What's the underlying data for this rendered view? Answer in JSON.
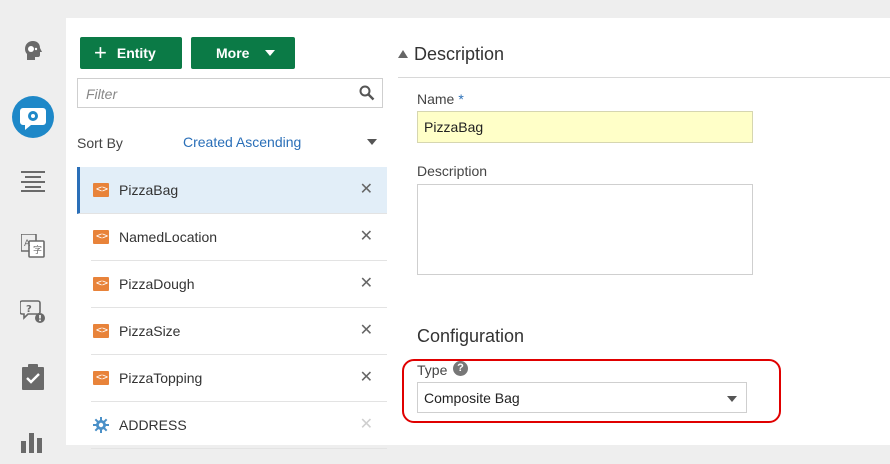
{
  "nav": {
    "items": [
      {
        "icon": "head-bubble-icon"
      },
      {
        "icon": "chat-gear-icon",
        "active": true,
        "color": "#1e88c8"
      },
      {
        "icon": "lines-icon"
      },
      {
        "icon": "translate-icon"
      },
      {
        "icon": "question-chat-icon"
      },
      {
        "icon": "clipboard-check-icon"
      },
      {
        "icon": "bar-chart-icon"
      }
    ]
  },
  "toolbar": {
    "entity_label": "Entity",
    "entity_plus": "+",
    "more_label": "More",
    "accent_color": "#0b7a46"
  },
  "filter": {
    "placeholder": "Filter"
  },
  "sort": {
    "label": "Sort By",
    "value": "Created Ascending"
  },
  "entities": [
    {
      "name": "PizzaBag",
      "icon": "bag-entity-icon",
      "selected": true
    },
    {
      "name": "NamedLocation",
      "icon": "entity-icon"
    },
    {
      "name": "PizzaDough",
      "icon": "entity-icon"
    },
    {
      "name": "PizzaSize",
      "icon": "entity-icon"
    },
    {
      "name": "PizzaTopping",
      "icon": "entity-icon"
    },
    {
      "name": "ADDRESS",
      "icon": "gear-icon"
    }
  ],
  "delete_glyph": "✕",
  "entity_icon_glyph": "<>",
  "description_section": {
    "heading": "Description",
    "name_label": "Name",
    "required_mark": "*",
    "name_value": "PizzaBag",
    "description_label": "Description",
    "description_value": ""
  },
  "configuration_section": {
    "heading": "Configuration",
    "type_label": "Type",
    "help_glyph": "?",
    "type_value": "Composite Bag"
  }
}
